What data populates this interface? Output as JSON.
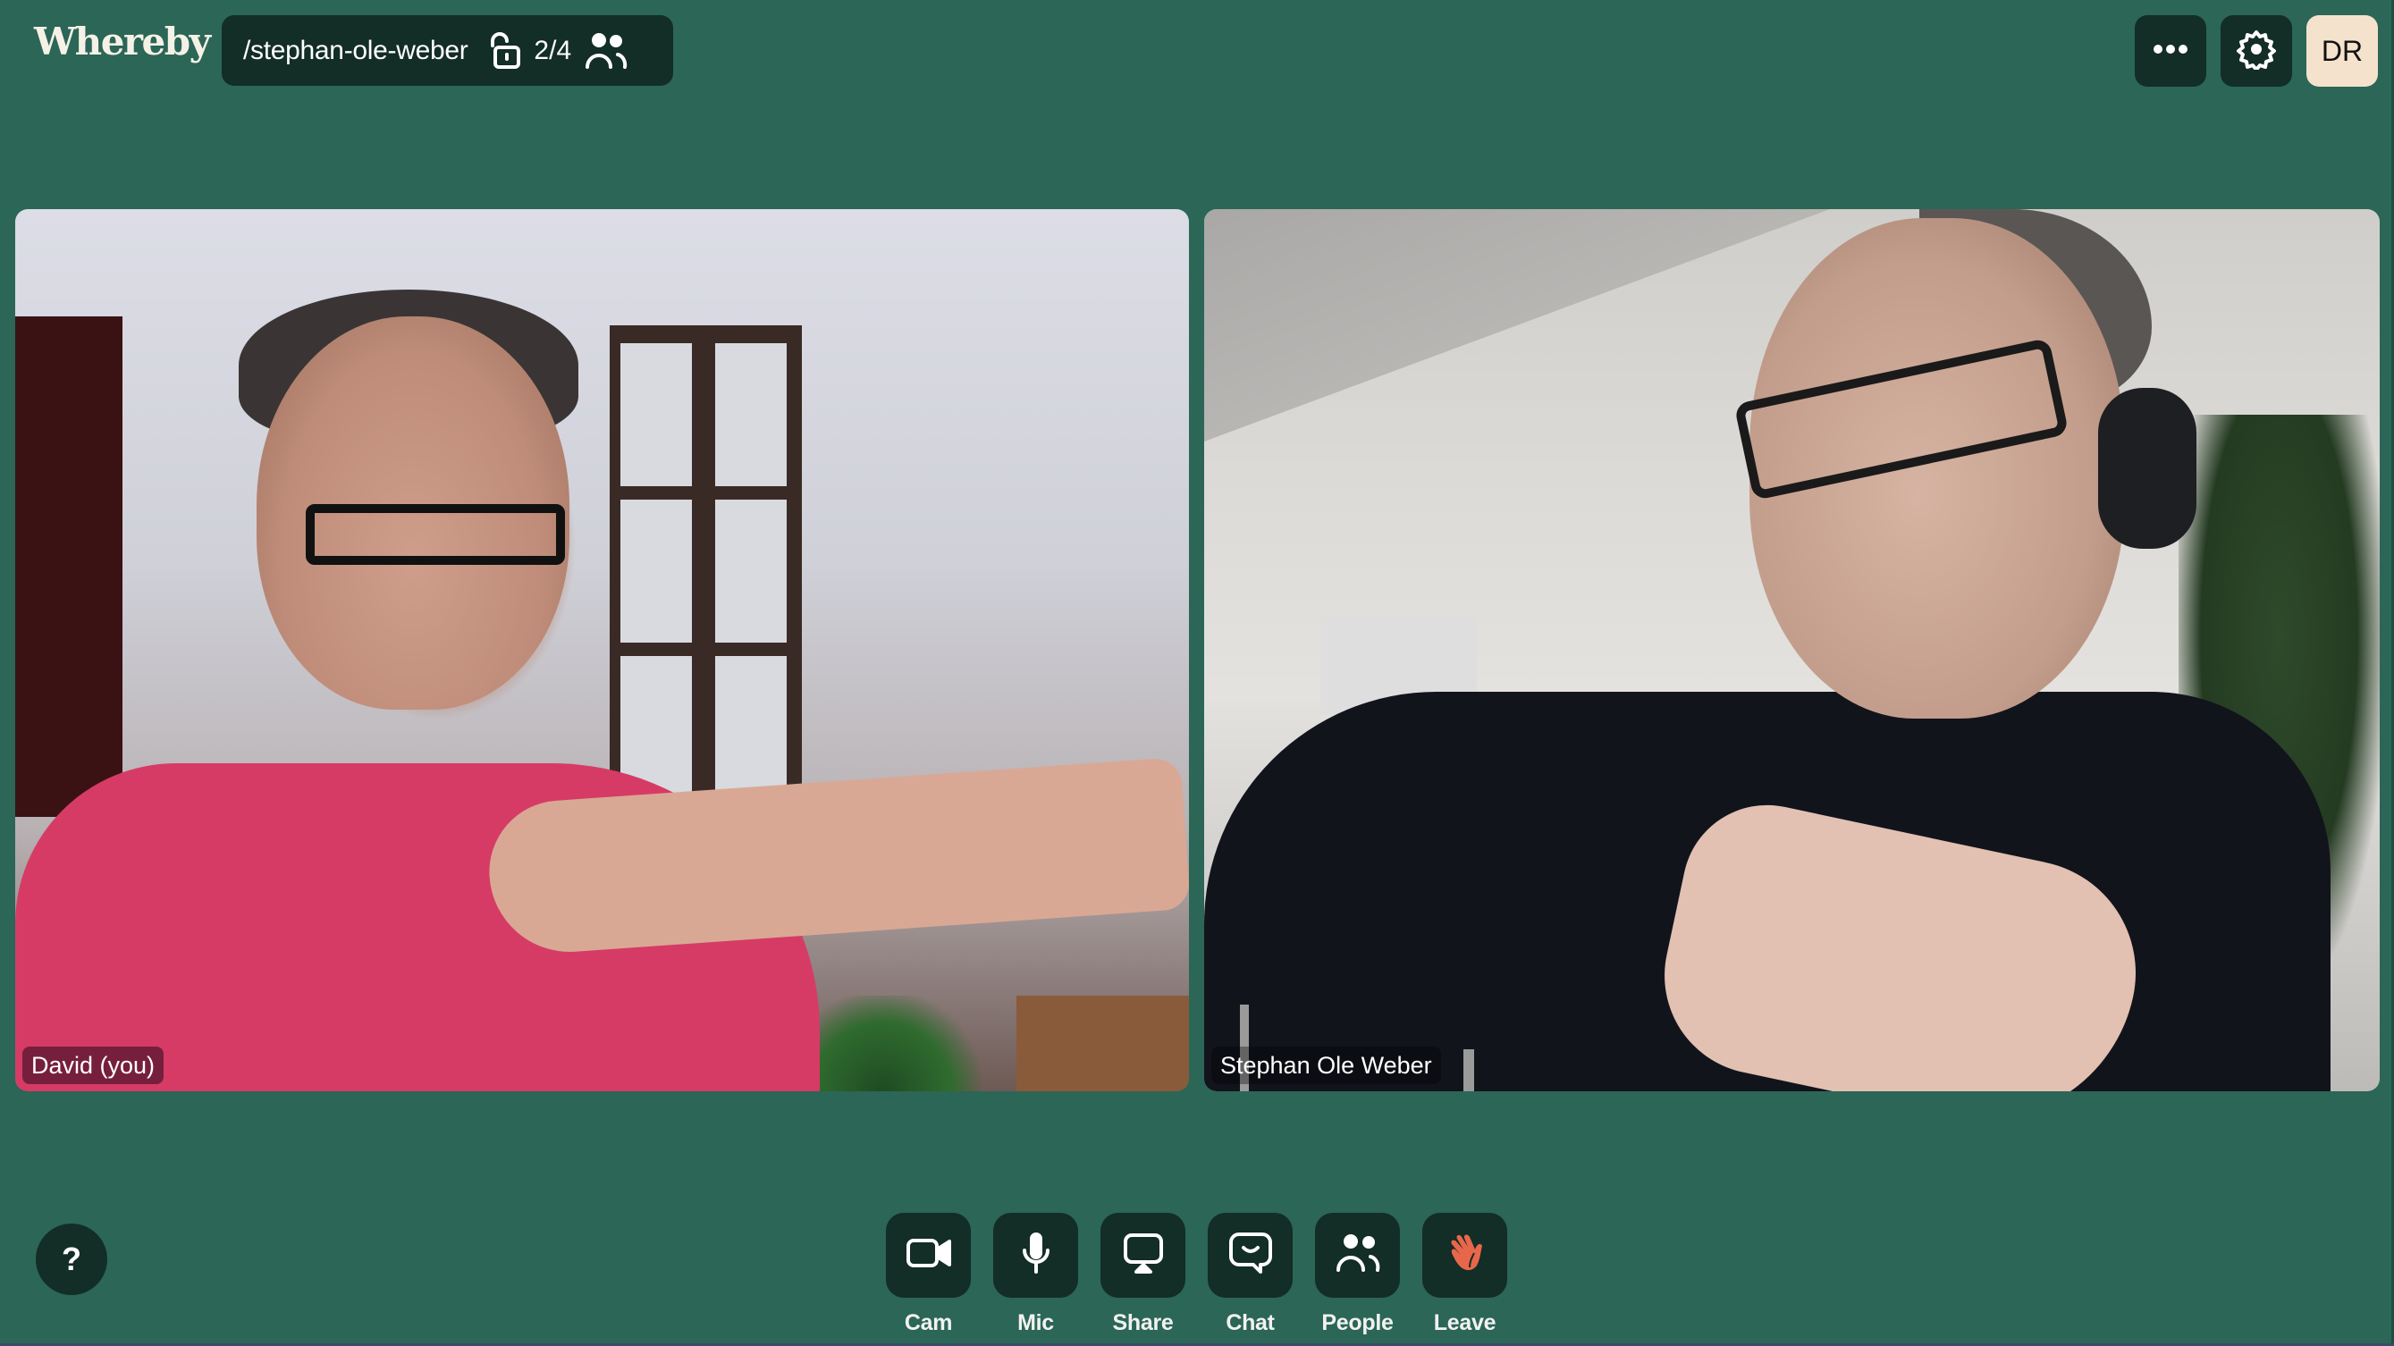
{
  "header": {
    "logo": "Whereby",
    "room_name": "/stephan-ole-weber",
    "room_lock_icon": "unlocked-padlock-icon",
    "participant_count": "2/4",
    "participants_icon": "people-icon",
    "more_icon": "more-horizontal-icon",
    "settings_icon": "gear-icon",
    "avatar_initials": "DR"
  },
  "videos": [
    {
      "name": "David (you)",
      "is_self": true
    },
    {
      "name": "Stephan Ole Weber",
      "is_self": false
    }
  ],
  "help": {
    "label": "?"
  },
  "toolbar": {
    "items": [
      {
        "label": "Cam",
        "icon": "camera-icon"
      },
      {
        "label": "Mic",
        "icon": "microphone-icon"
      },
      {
        "label": "Share",
        "icon": "screen-share-icon"
      },
      {
        "label": "Chat",
        "icon": "chat-icon"
      },
      {
        "label": "People",
        "icon": "people-icon"
      },
      {
        "label": "Leave",
        "icon": "waving-hand-icon"
      }
    ]
  },
  "colors": {
    "background": "#2B6657",
    "button_dark": "#132D27",
    "avatar_bg": "#F4E2CC",
    "leave_accent": "#E8674A"
  }
}
